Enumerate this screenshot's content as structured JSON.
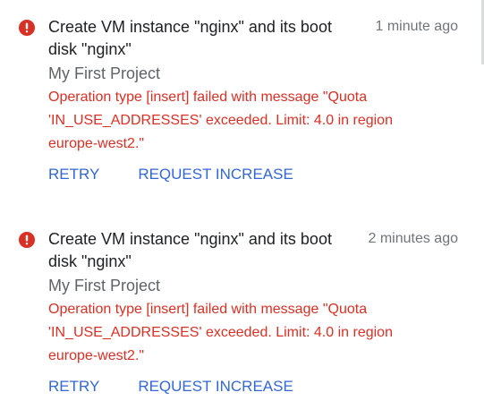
{
  "colors": {
    "error": "#d93025",
    "link": "#3367d6",
    "title": "#202124",
    "muted": "#70757a"
  },
  "notifications": [
    {
      "icon": "error-icon",
      "title": "Create VM instance \"nginx\" and its boot disk \"nginx\"",
      "time": "1 minute ago",
      "project": "My First Project",
      "message": "Operation type [insert] failed with message \"Quota 'IN_USE_ADDRESSES' exceeded. Limit: 4.0 in region europe-west2.\"",
      "retry_label": "RETRY",
      "request_label": "REQUEST INCREASE"
    },
    {
      "icon": "error-icon",
      "title": "Create VM instance \"nginx\" and its boot disk \"nginx\"",
      "time": "2 minutes ago",
      "project": "My First Project",
      "message": "Operation type [insert] failed with message \"Quota 'IN_USE_ADDRESSES' exceeded. Limit: 4.0 in region europe-west2.\"",
      "retry_label": "RETRY",
      "request_label": "REQUEST INCREASE"
    }
  ]
}
